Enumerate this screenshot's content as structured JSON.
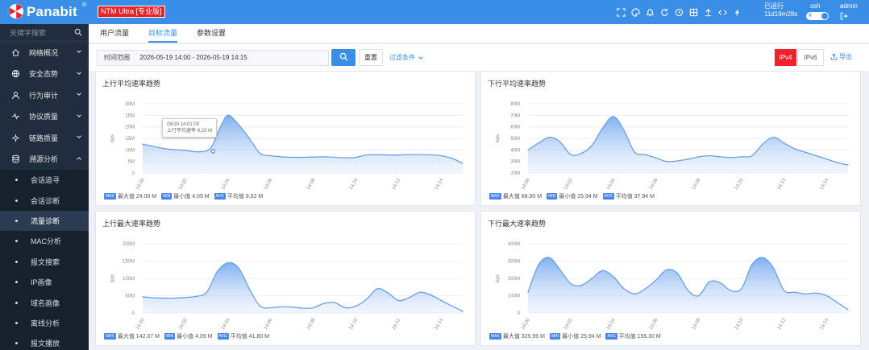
{
  "header": {
    "logo": "Panabit",
    "logo_reg": "®",
    "edition": "NTM Ultra [专业版]",
    "runtime_label": "已运行",
    "runtime_value": "11d19m28s",
    "ssh_label": "ssh",
    "user": "admin"
  },
  "sidebar": {
    "search_placeholder": "关键字搜索",
    "menu": [
      {
        "label": "网络概况",
        "icon": "home-icon"
      },
      {
        "label": "安全态势",
        "icon": "globe-icon"
      },
      {
        "label": "行为审计",
        "icon": "user-icon"
      },
      {
        "label": "协议质量",
        "icon": "pulse-icon"
      },
      {
        "label": "链路质量",
        "icon": "network-icon"
      },
      {
        "label": "溯源分析",
        "icon": "database-icon"
      }
    ],
    "submenu": [
      {
        "label": "会话追寻"
      },
      {
        "label": "会话诊断"
      },
      {
        "label": "流量诊断",
        "active": true
      },
      {
        "label": "MAC分析"
      },
      {
        "label": "报文搜索"
      },
      {
        "label": "IP画像"
      },
      {
        "label": "域名画像"
      },
      {
        "label": "离线分析"
      },
      {
        "label": "报文播放"
      }
    ]
  },
  "tabs": [
    "用户流量",
    "目标流量",
    "参数设置"
  ],
  "active_tab": 1,
  "filter": {
    "time_label": "时间范围",
    "time_range": "2026-05-19 14:00 - 2026-05-19 14:15",
    "reset_label": "重置",
    "filter_cond_label": "过滤条件",
    "ipv4_label": "IPv4",
    "ipv6_label": "IPv6",
    "export_label": "导出"
  },
  "colors": {
    "accent": "#3a8ee6",
    "danger": "#f5222d",
    "sidebar_bg": "#1f2d3d",
    "series_line": "#6a9fe6"
  },
  "panels": [
    {
      "title": "上行平均速率趋势",
      "yunit": "bps",
      "legend": [
        {
          "badge": "MAX",
          "text": "最大值 24.00 M"
        },
        {
          "badge": "MIN",
          "text": "最小值 4.09 M"
        },
        {
          "badge": "AVG",
          "text": "平均值 9.52 M"
        }
      ],
      "tooltip": {
        "line1": "05/19 14:01:00",
        "line2": "上行平均速率 9.23 M"
      }
    },
    {
      "title": "下行平均速率趋势",
      "yunit": "bps",
      "legend": [
        {
          "badge": "MAX",
          "text": "最大值 68.90 M"
        },
        {
          "badge": "MIN",
          "text": "最小值 25.94 M"
        },
        {
          "badge": "AVG",
          "text": "平均值 37.94 M"
        }
      ]
    },
    {
      "title": "上行最大速率趋势",
      "yunit": "bps",
      "legend": [
        {
          "badge": "MAX",
          "text": "最大值 142.07 M"
        },
        {
          "badge": "MIN",
          "text": "最小值 4.09 M"
        },
        {
          "badge": "AVG",
          "text": "平均值 41.80 M"
        }
      ]
    },
    {
      "title": "下行最大速率趋势",
      "yunit": "bps",
      "legend": [
        {
          "badge": "MAX",
          "text": "最大值 325.95 M"
        },
        {
          "badge": "MIN",
          "text": "最小值 25.94 M"
        },
        {
          "badge": "AVG",
          "text": "平均值 155.30 M"
        }
      ]
    }
  ],
  "chart_data": [
    {
      "type": "area",
      "title": "上行平均速率趋势",
      "ylabel": "bps",
      "yticks": [
        "0",
        "5M",
        "10M",
        "15M",
        "20M",
        "25M",
        "30M"
      ],
      "ylim": [
        0,
        30
      ],
      "xticks": [
        "14:00",
        "14:02",
        "14:04",
        "14:06",
        "14:08",
        "14:10",
        "14:12",
        "14:14"
      ],
      "x": [
        0,
        0.5,
        1,
        1.5,
        2,
        2.5,
        3,
        3.3,
        3.7,
        4,
        4.4,
        5,
        5.5,
        6,
        6.5,
        7,
        7.5,
        8,
        8.5,
        9,
        9.5,
        10,
        10.5,
        11,
        11.5,
        12,
        12.5,
        13,
        13.5,
        14,
        14.5,
        15
      ],
      "series": [
        {
          "values": [
            12.5,
            11.5,
            10.6,
            10.1,
            9.8,
            9.2,
            9.6,
            12.5,
            21,
            25,
            22,
            15,
            8.5,
            7.5,
            7,
            6.8,
            6.8,
            6.9,
            7,
            6.8,
            6.6,
            6.8,
            7.8,
            8,
            7.8,
            7.8,
            8,
            8,
            7.9,
            7.5,
            6.3,
            4.2
          ]
        }
      ]
    },
    {
      "type": "area",
      "title": "下行平均速率趋势",
      "ylabel": "bps",
      "yticks": [
        "20M",
        "30M",
        "40M",
        "50M",
        "60M",
        "70M",
        "80M"
      ],
      "ylim": [
        20,
        80
      ],
      "xticks": [
        "14:00",
        "14:02",
        "14:04",
        "14:06",
        "14:08",
        "14:10",
        "14:12",
        "14:14"
      ],
      "x": [
        0,
        0.5,
        1,
        1.5,
        2,
        2.5,
        3,
        3.5,
        4,
        4.5,
        5,
        5.5,
        6,
        6.5,
        7,
        7.5,
        8,
        8.5,
        9,
        9.5,
        10,
        10.5,
        11,
        11.5,
        12,
        12.5,
        13,
        13.5,
        14,
        14.5,
        15
      ],
      "series": [
        {
          "values": [
            40,
            46,
            51,
            47,
            36,
            37,
            44,
            59,
            69,
            57,
            38,
            36,
            33,
            30,
            30.5,
            32,
            34,
            35,
            34,
            33.5,
            34,
            35,
            45,
            51,
            46,
            41,
            38,
            35,
            32,
            29,
            27
          ]
        }
      ]
    },
    {
      "type": "area",
      "title": "上行最大速率趋势",
      "ylabel": "bps",
      "yticks": [
        "0",
        "50M",
        "100M",
        "150M",
        "200M"
      ],
      "ylim": [
        0,
        200
      ],
      "xticks": [
        "14:00",
        "14:02",
        "14:04",
        "14:06",
        "14:08",
        "14:10",
        "14:12",
        "14:14"
      ],
      "x": [
        0,
        0.5,
        1,
        1.5,
        2,
        2.5,
        3,
        3.5,
        4,
        4.5,
        5,
        5.5,
        6,
        6.5,
        7,
        7.5,
        8,
        8.5,
        9,
        9.5,
        10,
        10.5,
        11,
        11.5,
        12,
        12.5,
        13,
        13.5,
        14,
        14.5,
        15
      ],
      "series": [
        {
          "values": [
            47,
            44,
            43,
            43,
            45,
            48,
            60,
            120,
            145,
            130,
            70,
            20,
            15,
            18,
            17,
            14,
            15,
            28,
            30,
            15,
            20,
            40,
            70,
            58,
            36,
            45,
            60,
            52,
            36,
            20,
            5
          ]
        }
      ]
    },
    {
      "type": "area",
      "title": "下行最大速率趋势",
      "ylabel": "bps",
      "yticks": [
        "0",
        "100M",
        "200M",
        "300M",
        "400M"
      ],
      "ylim": [
        0,
        400
      ],
      "xticks": [
        "14:00",
        "14:02",
        "14:04",
        "14:06",
        "14:08",
        "14:10",
        "14:12",
        "14:14"
      ],
      "x": [
        0,
        0.5,
        1,
        1.5,
        2,
        2.5,
        3,
        3.5,
        4,
        4.5,
        5,
        5.5,
        6,
        6.5,
        7,
        7.5,
        8,
        8.5,
        9,
        9.5,
        10,
        10.5,
        11,
        11.5,
        12,
        12.5,
        13,
        13.5,
        14,
        14.5,
        15
      ],
      "series": [
        {
          "values": [
            120,
            280,
            320,
            250,
            170,
            160,
            200,
            245,
            210,
            140,
            110,
            140,
            190,
            250,
            230,
            130,
            100,
            180,
            175,
            130,
            140,
            280,
            320,
            260,
            130,
            120,
            110,
            115,
            100,
            60,
            20
          ]
        }
      ]
    }
  ]
}
